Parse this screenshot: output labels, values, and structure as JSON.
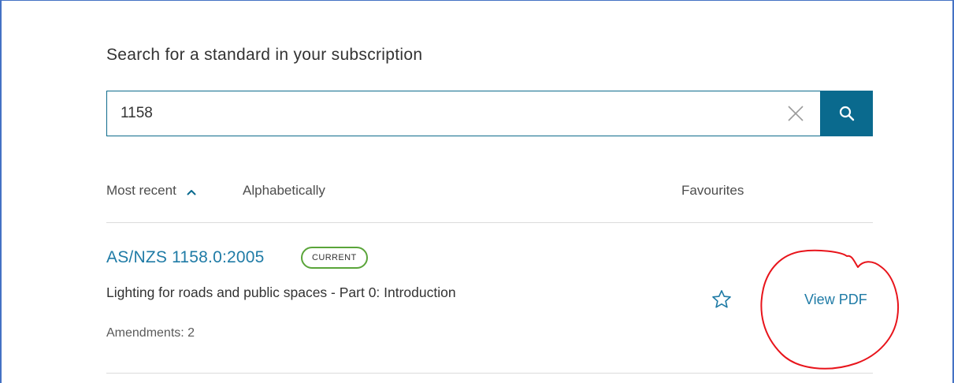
{
  "search": {
    "heading": "Search for a standard in your subscription",
    "value": "1158",
    "placeholder": ""
  },
  "sort": {
    "most_recent": "Most recent",
    "alphabetically": "Alphabetically",
    "favourites": "Favourites"
  },
  "results": [
    {
      "code": "AS/NZS 1158.0:2005",
      "status": "CURRENT",
      "title": "Lighting for roads and public spaces - Part 0: Introduction",
      "amendments": "Amendments: 2",
      "action": "View PDF"
    }
  ],
  "icons": {
    "clear": "close-icon",
    "search": "search-icon",
    "sort": "chevron-up-icon",
    "favourite": "star-outline-icon"
  },
  "colors": {
    "accent": "#0a6a8e",
    "link": "#1f7ba6",
    "status_current": "#5aa53a",
    "annotation": "#e8141b",
    "frame": "#4472c4"
  }
}
